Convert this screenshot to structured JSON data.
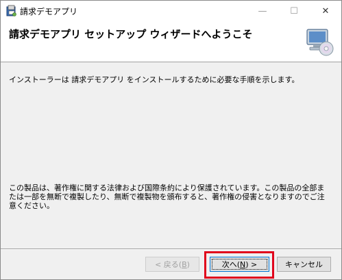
{
  "window": {
    "title": "請求デモアプリ",
    "minimize_glyph": "—",
    "maximize_glyph": "☐",
    "close_glyph": "✕"
  },
  "banner": {
    "title": "請求デモアプリ セットアップ ウィザードへようこそ",
    "icon": "computer-cd-icon"
  },
  "body": {
    "intro": "インストーラーは 請求デモアプリ をインストールするために必要な手順を示します。",
    "warning": "この製品は、著作権に関する法律および国際条約により保護されています。この製品の全部または一部を無断で複製したり、無断で複製物を頒布すると、著作権の侵害となりますのでご注意ください。"
  },
  "buttons": {
    "back": {
      "label_prefix": "< 戻る(",
      "accel": "B",
      "label_suffix": ")",
      "enabled": false
    },
    "next": {
      "label_prefix": "次へ(",
      "accel": "N",
      "label_suffix": ") >",
      "enabled": true
    },
    "cancel": {
      "label": "キャンセル",
      "enabled": true
    }
  },
  "colors": {
    "highlight": "#e0001b",
    "focus_border": "#0078d7"
  }
}
